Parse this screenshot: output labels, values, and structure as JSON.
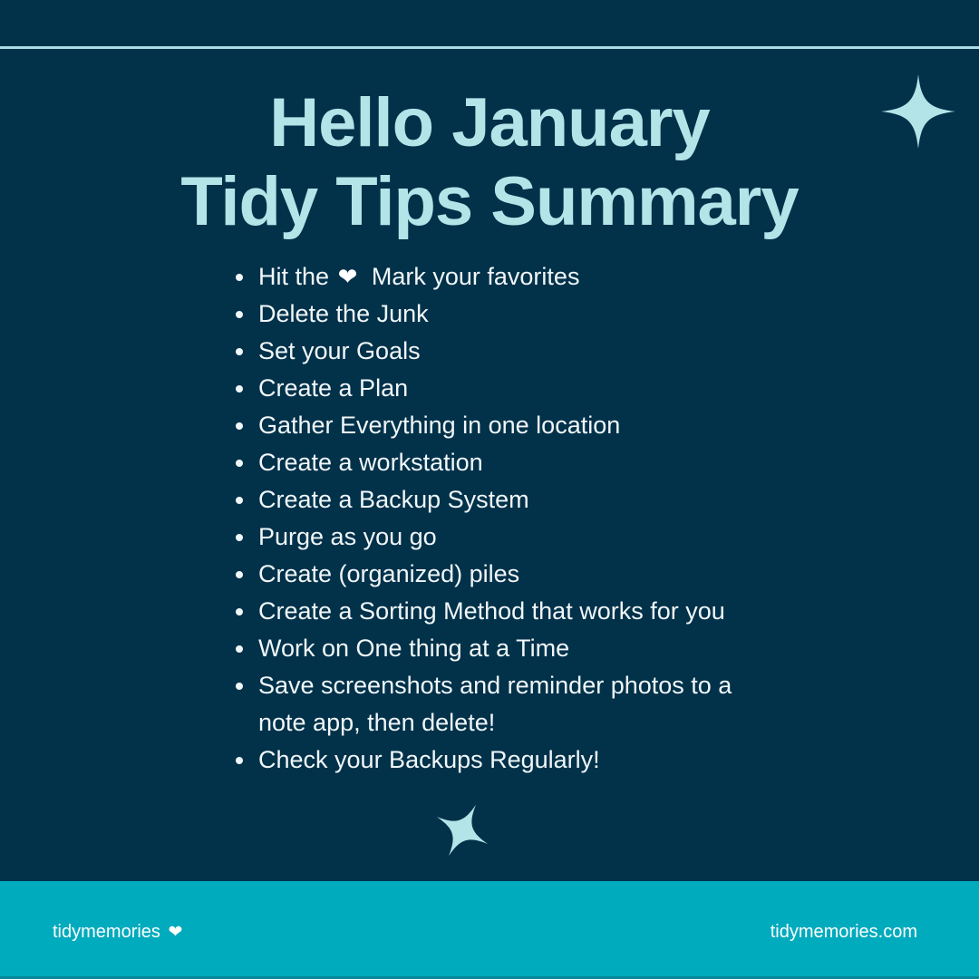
{
  "colors": {
    "background": "#02314a",
    "accent": "#b3e5e8",
    "text": "#f0f7f8",
    "footer": "#00abbd"
  },
  "title": {
    "line1": "Hello January",
    "line2": "Tidy Tips Summary"
  },
  "tips": [
    {
      "before": "Hit the",
      "icon": "heart-icon",
      "icon_glyph": "❤",
      "after": "Mark your favorites"
    },
    {
      "text": "Delete the Junk"
    },
    {
      "text": "Set your Goals"
    },
    {
      "text": "Create a Plan"
    },
    {
      "text": "Gather Everything in one location"
    },
    {
      "text": "Create a workstation"
    },
    {
      "text": "Create a Backup System"
    },
    {
      "text": "Purge as you go"
    },
    {
      "text": "Create (organized) piles"
    },
    {
      "text": "Create a Sorting Method that works for you"
    },
    {
      "text": "Work on One thing at a Time"
    },
    {
      "text": "Save screenshots and reminder photos to a note app, then delete!"
    },
    {
      "text": "Check your Backups Regularly!"
    }
  ],
  "decorations": {
    "top_right": "sparkle-icon",
    "bottom_center": "sparkle-icon"
  },
  "footer": {
    "brand": "tidymemories",
    "brand_icon": "heart-icon",
    "brand_icon_glyph": "❤",
    "website": "tidymemories.com"
  }
}
